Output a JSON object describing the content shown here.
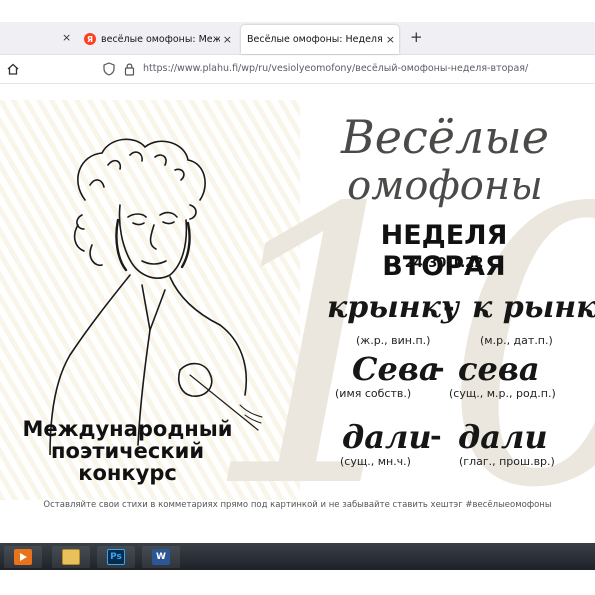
{
  "browser": {
    "tabs": [
      {
        "title": "весёлые омофоны: Международ",
        "favicon": "yandex-icon"
      },
      {
        "title": "Весёлые омофоны: Неделя вторая",
        "active": true
      }
    ],
    "close_glyph": "×",
    "new_tab_glyph": "+",
    "url": "https://www.plahu.fi/wp/ru/vesiolyeomofony/весёлый-омофоны-неделя-вторая/"
  },
  "poster": {
    "title_line1": "Весёлые",
    "title_line2": "омофоны",
    "week": "НЕДЕЛЯ ВТОРАЯ",
    "dates": "24-30.1.22",
    "contest": [
      "Международный",
      "поэтический",
      "конкурс"
    ],
    "pairs": [
      {
        "left": "крынку",
        "right": "к рынку",
        "left_note": "(ж.р., вин.п.)",
        "right_note": "(м.р., дат.п.)"
      },
      {
        "left": "Сева",
        "right": "сева",
        "left_note": "(имя собств.)",
        "right_note": "(сущ., м.р., род.п.)"
      },
      {
        "left": "дали",
        "right": "дали",
        "left_note": "(сущ., мн.ч.)",
        "right_note": "(глаг., прош.вр.)"
      }
    ],
    "dash": "-"
  },
  "caption": "Оставляйте свои стихи в комметариях прямо под картинкой и не забывайте ставить хештэг #весёлыеомофоны",
  "taskbar": {
    "apps": [
      {
        "name": "media-player-icon",
        "color": "#e8731a"
      },
      {
        "name": "file-explorer-icon",
        "color": "#e8c15a"
      },
      {
        "name": "photoshop-icon",
        "color": "#0a2a4a",
        "label": "Ps"
      },
      {
        "name": "word-icon",
        "color": "#2b5797",
        "label": "W"
      }
    ]
  }
}
